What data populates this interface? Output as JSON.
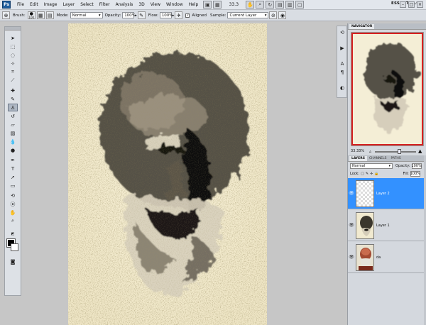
{
  "app": {
    "logo": "Ps"
  },
  "menu": [
    "File",
    "Edit",
    "Image",
    "Layer",
    "Select",
    "Filter",
    "Analysis",
    "3D",
    "View",
    "Window",
    "Help"
  ],
  "menubar": {
    "zoom_value": "33.3",
    "workspace": "ESSENTIALS",
    "icons": [
      "hand-icon",
      "zoom-icon",
      "rotate-icon",
      "grid-icon",
      "arrange-icon",
      "screen-mode-icon"
    ]
  },
  "options": {
    "brush_label": "Brush:",
    "brush_size": "100",
    "mode_label": "Mode:",
    "mode_value": "Normal",
    "opacity_label": "Opacity:",
    "opacity_value": "100%",
    "flow_label": "Flow:",
    "flow_value": "100%",
    "aligned_label": "Aligned",
    "sample_label": "Sample:",
    "sample_value": "Current Layer"
  },
  "tools": [
    "move",
    "marquee",
    "lasso",
    "quick-select",
    "crop",
    "eyedropper",
    "healing",
    "brush",
    "clone-stamp",
    "history-brush",
    "eraser",
    "gradient",
    "blur",
    "dodge",
    "pen",
    "type",
    "path-select",
    "shape",
    "3d-rotate",
    "3d-camera",
    "hand",
    "zoom"
  ],
  "navigator": {
    "tabs": [
      "NAVIGATOR"
    ],
    "zoom": "33.33%"
  },
  "layers_panel": {
    "tabs": [
      "LAYERS",
      "CHANNELS",
      "PATHS"
    ],
    "blend_mode": "Normal",
    "opacity_label": "Opacity:",
    "opacity_value": "100%",
    "lock_label": "Lock:",
    "fill_label": "Fill:",
    "fill_value": "100%",
    "layers": [
      {
        "name": "Layer 2",
        "selected": true
      },
      {
        "name": "Layer 1",
        "selected": false
      },
      {
        "name": "da",
        "selected": false
      }
    ]
  },
  "colors": {
    "accent": "#3391ff",
    "canvas_paper": "#f3ecd0"
  }
}
